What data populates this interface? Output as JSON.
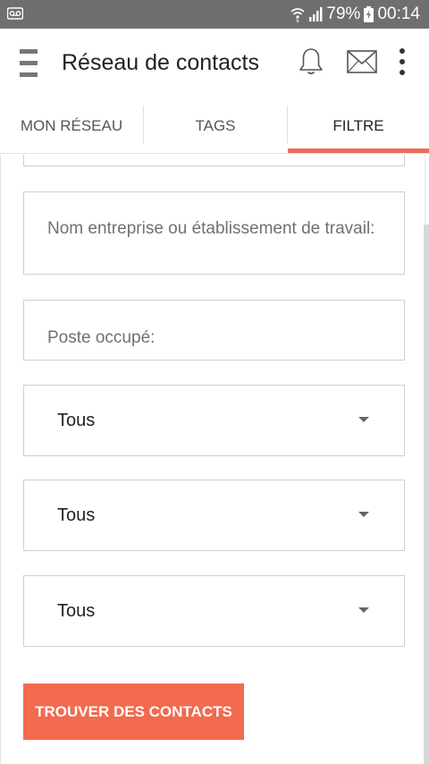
{
  "status_bar": {
    "battery": "79%",
    "time": "00:14",
    "icons": [
      "voicemail-icon",
      "wifi-icon",
      "signal-icon",
      "battery-charging-icon"
    ]
  },
  "app_bar": {
    "title": "Réseau de contacts",
    "icons": [
      "menu-icon",
      "bell-icon",
      "mail-icon",
      "more-vert-icon"
    ]
  },
  "tabs": [
    {
      "label": "MON RÉSEAU",
      "selected": false
    },
    {
      "label": "TAGS",
      "selected": false
    },
    {
      "label": "FILTRE",
      "selected": true
    }
  ],
  "colors": {
    "accent": "#f26a4f",
    "status_bar": "#6f6f6f"
  },
  "form": {
    "company_placeholder": "Nom entreprise ou établissement de travail:",
    "position_placeholder": "Poste occupé:",
    "selects": [
      {
        "value": "Tous"
      },
      {
        "value": "Tous"
      },
      {
        "value": "Tous"
      }
    ],
    "submit_label": "TROUVER DES CONTACTS"
  }
}
